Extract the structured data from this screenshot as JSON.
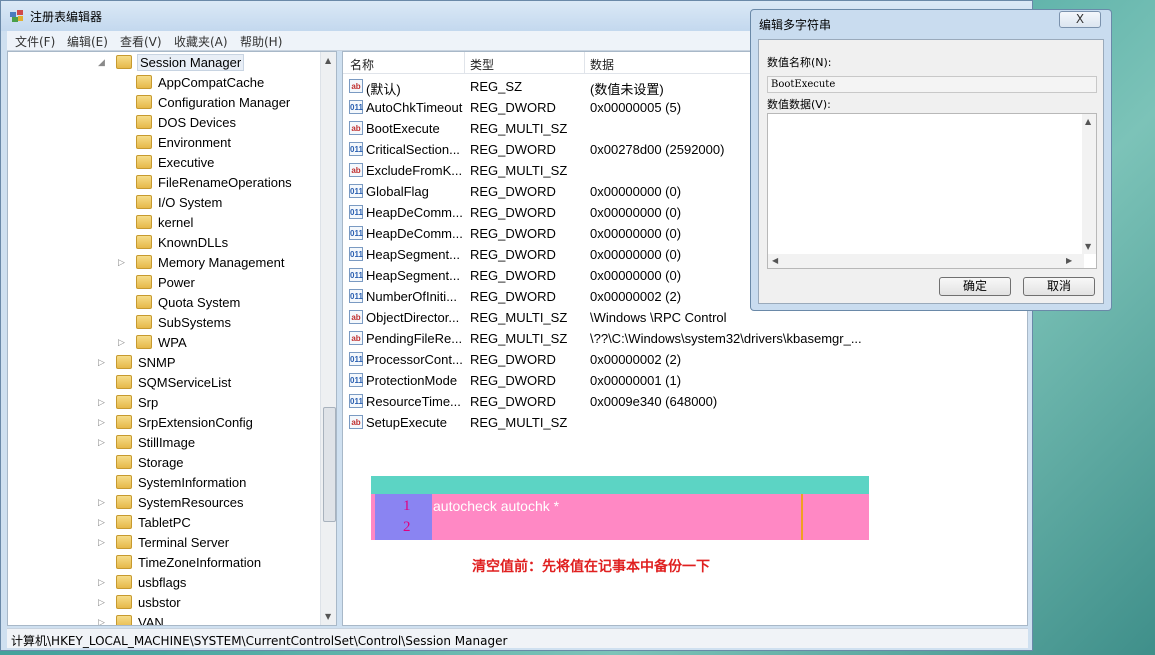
{
  "window": {
    "title": "注册表编辑器"
  },
  "menu": [
    "文件(F)",
    "编辑(E)",
    "查看(V)",
    "收藏夹(A)",
    "帮助(H)"
  ],
  "tree": [
    {
      "label": "Session Manager",
      "level": 0,
      "expanded": true,
      "selected": true
    },
    {
      "label": "AppCompatCache",
      "level": 1
    },
    {
      "label": "Configuration Manager",
      "level": 1
    },
    {
      "label": "DOS Devices",
      "level": 1
    },
    {
      "label": "Environment",
      "level": 1
    },
    {
      "label": "Executive",
      "level": 1
    },
    {
      "label": "FileRenameOperations",
      "level": 1
    },
    {
      "label": "I/O System",
      "level": 1
    },
    {
      "label": "kernel",
      "level": 1
    },
    {
      "label": "KnownDLLs",
      "level": 1
    },
    {
      "label": "Memory Management",
      "level": 1,
      "expandable": true
    },
    {
      "label": "Power",
      "level": 1
    },
    {
      "label": "Quota System",
      "level": 1
    },
    {
      "label": "SubSystems",
      "level": 1
    },
    {
      "label": "WPA",
      "level": 1,
      "expandable": true
    },
    {
      "label": "SNMP",
      "level": 0,
      "expandable": true
    },
    {
      "label": "SQMServiceList",
      "level": 0
    },
    {
      "label": "Srp",
      "level": 0,
      "expandable": true
    },
    {
      "label": "SrpExtensionConfig",
      "level": 0,
      "expandable": true
    },
    {
      "label": "StillImage",
      "level": 0,
      "expandable": true
    },
    {
      "label": "Storage",
      "level": 0
    },
    {
      "label": "SystemInformation",
      "level": 0
    },
    {
      "label": "SystemResources",
      "level": 0,
      "expandable": true
    },
    {
      "label": "TabletPC",
      "level": 0,
      "expandable": true
    },
    {
      "label": "Terminal Server",
      "level": 0,
      "expandable": true
    },
    {
      "label": "TimeZoneInformation",
      "level": 0
    },
    {
      "label": "usbflags",
      "level": 0,
      "expandable": true
    },
    {
      "label": "usbstor",
      "level": 0,
      "expandable": true
    },
    {
      "label": "VAN",
      "level": 0,
      "expandable": true
    }
  ],
  "columns": {
    "name": "名称",
    "type": "类型",
    "data": "数据"
  },
  "values": [
    {
      "icon": "ab",
      "name": "(默认)",
      "type": "REG_SZ",
      "data": "(数值未设置)"
    },
    {
      "icon": "bin",
      "name": "AutoChkTimeout",
      "type": "REG_DWORD",
      "data": "0x00000005 (5)"
    },
    {
      "icon": "ab",
      "name": "BootExecute",
      "type": "REG_MULTI_SZ",
      "data": ""
    },
    {
      "icon": "bin",
      "name": "CriticalSection...",
      "type": "REG_DWORD",
      "data": "0x00278d00 (2592000)"
    },
    {
      "icon": "ab",
      "name": "ExcludeFromK...",
      "type": "REG_MULTI_SZ",
      "data": ""
    },
    {
      "icon": "bin",
      "name": "GlobalFlag",
      "type": "REG_DWORD",
      "data": "0x00000000 (0)"
    },
    {
      "icon": "bin",
      "name": "HeapDeComm...",
      "type": "REG_DWORD",
      "data": "0x00000000 (0)"
    },
    {
      "icon": "bin",
      "name": "HeapDeComm...",
      "type": "REG_DWORD",
      "data": "0x00000000 (0)"
    },
    {
      "icon": "bin",
      "name": "HeapSegment...",
      "type": "REG_DWORD",
      "data": "0x00000000 (0)"
    },
    {
      "icon": "bin",
      "name": "HeapSegment...",
      "type": "REG_DWORD",
      "data": "0x00000000 (0)"
    },
    {
      "icon": "bin",
      "name": "NumberOfIniti...",
      "type": "REG_DWORD",
      "data": "0x00000002 (2)"
    },
    {
      "icon": "ab",
      "name": "ObjectDirector...",
      "type": "REG_MULTI_SZ",
      "data": "\\Windows \\RPC Control"
    },
    {
      "icon": "ab",
      "name": "PendingFileRe...",
      "type": "REG_MULTI_SZ",
      "data": "\\??\\C:\\Windows\\system32\\drivers\\kbasemgr_..."
    },
    {
      "icon": "bin",
      "name": "ProcessorCont...",
      "type": "REG_DWORD",
      "data": "0x00000002 (2)"
    },
    {
      "icon": "bin",
      "name": "ProtectionMode",
      "type": "REG_DWORD",
      "data": "0x00000001 (1)"
    },
    {
      "icon": "bin",
      "name": "ResourceTime...",
      "type": "REG_DWORD",
      "data": "0x0009e340 (648000)"
    },
    {
      "icon": "ab",
      "name": "SetupExecute",
      "type": "REG_MULTI_SZ",
      "data": ""
    }
  ],
  "annotation": {
    "line_numbers": [
      "1",
      "2"
    ],
    "text": "autocheck autochk *",
    "note": "清空值前：先将值在记事本中备份一下"
  },
  "status_path": "计算机\\HKEY_LOCAL_MACHINE\\SYSTEM\\CurrentControlSet\\Control\\Session Manager",
  "dialog": {
    "title": "编辑多字符串",
    "close": "X",
    "name_label": "数值名称(N):",
    "name_value": "BootExecute",
    "data_label": "数值数据(V):",
    "ok": "确定",
    "cancel": "取消"
  }
}
